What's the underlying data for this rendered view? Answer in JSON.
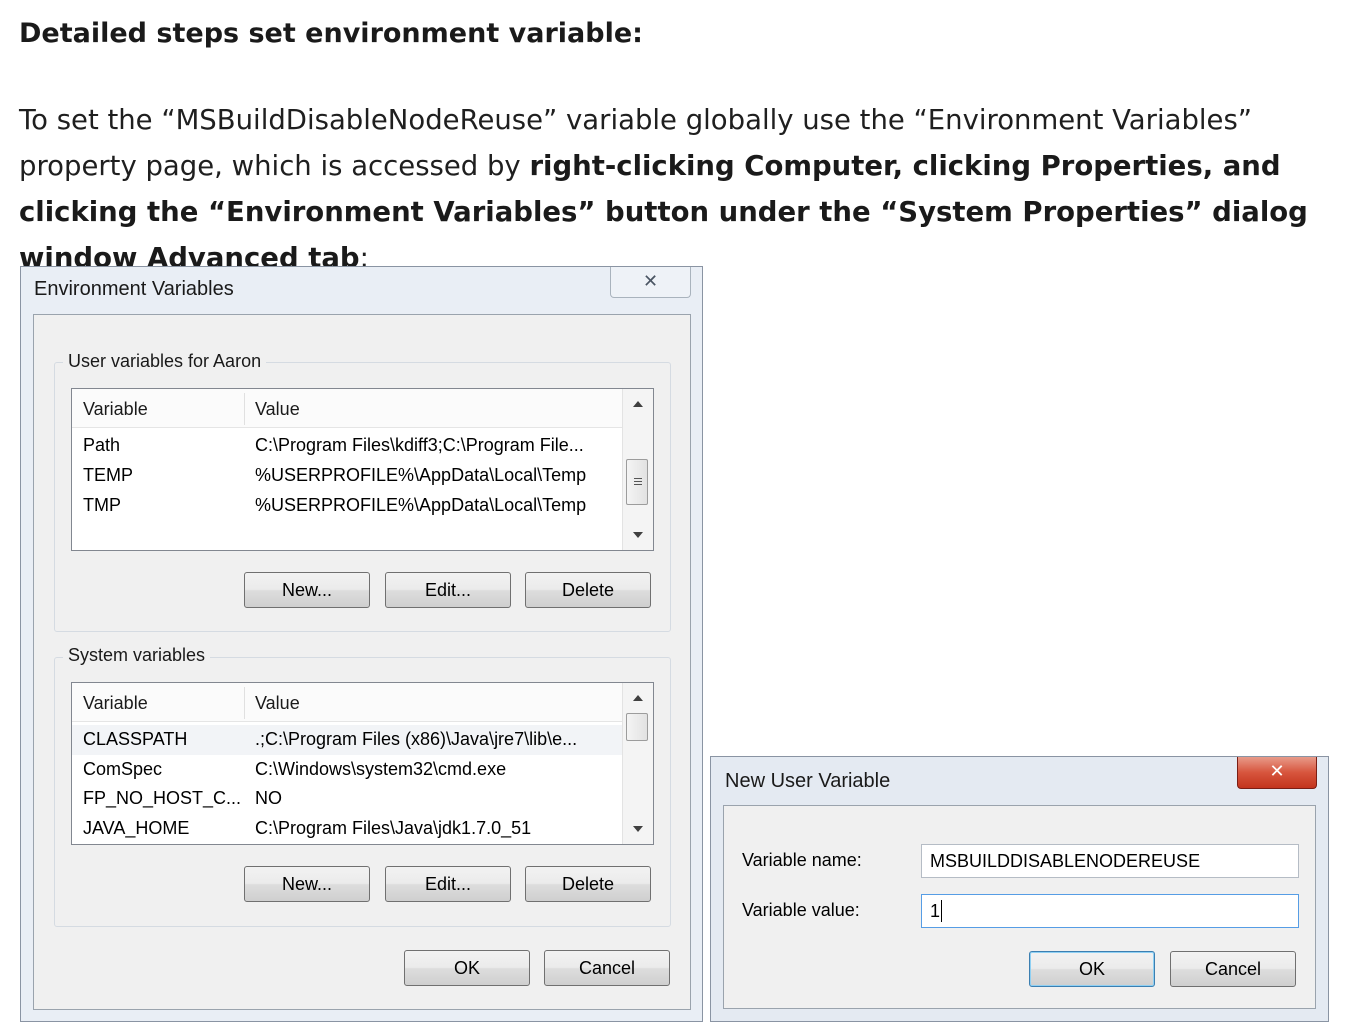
{
  "article": {
    "heading": "Detailed steps set environment variable:",
    "para_1": "To set the “MSBuildDisableNodeReuse” variable globally use the “Environment Variables” property page, which is accessed by ",
    "para_bold": "right-clicking Computer, clicking Properties, and clicking the “Environment Variables” button under the “System Properties” dialog window Advanced tab",
    "para_end": ":"
  },
  "env_dialog": {
    "title": "Environment Variables",
    "close_glyph": "✕",
    "user_group": {
      "label": "User variables for Aaron",
      "columns": [
        "Variable",
        "Value"
      ],
      "rows": [
        {
          "variable": "Path",
          "value": "C:\\Program Files\\kdiff3;C:\\Program File..."
        },
        {
          "variable": "TEMP",
          "value": "%USERPROFILE%\\AppData\\Local\\Temp"
        },
        {
          "variable": "TMP",
          "value": "%USERPROFILE%\\AppData\\Local\\Temp"
        }
      ],
      "buttons": {
        "new": "New...",
        "edit": "Edit...",
        "delete": "Delete"
      }
    },
    "system_group": {
      "label": "System variables",
      "columns": [
        "Variable",
        "Value"
      ],
      "rows": [
        {
          "variable": "CLASSPATH",
          "value": ".;C:\\Program Files (x86)\\Java\\jre7\\lib\\e..."
        },
        {
          "variable": "ComSpec",
          "value": "C:\\Windows\\system32\\cmd.exe"
        },
        {
          "variable": "FP_NO_HOST_C...",
          "value": "NO"
        },
        {
          "variable": "JAVA_HOME",
          "value": "C:\\Program Files\\Java\\jdk1.7.0_51"
        }
      ],
      "buttons": {
        "new": "New...",
        "edit": "Edit...",
        "delete": "Delete"
      }
    },
    "ok": "OK",
    "cancel": "Cancel"
  },
  "new_var_dialog": {
    "title": "New User Variable",
    "close_glyph": "✕",
    "name_label": "Variable name:",
    "name_value": "MSBUILDDISABLENODEREUSE",
    "value_label": "Variable value:",
    "value_value": "1",
    "ok": "OK",
    "cancel": "Cancel"
  },
  "colors": {
    "dialog_frame": "#e9eef5",
    "dialog_body": "#f0f0f0",
    "close_red": "#c3341d",
    "default_button_border": "#3c7fb1"
  }
}
